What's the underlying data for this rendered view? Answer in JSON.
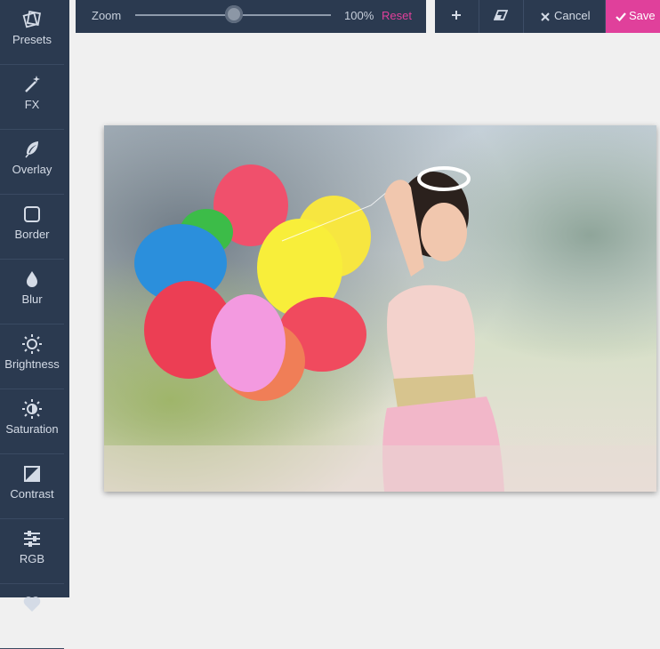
{
  "sidebar": {
    "items": [
      {
        "label": "Presets",
        "icon": "presets-icon"
      },
      {
        "label": "FX",
        "icon": "magic-wand-icon"
      },
      {
        "label": "Overlay",
        "icon": "feather-icon"
      },
      {
        "label": "Border",
        "icon": "square-border-icon"
      },
      {
        "label": "Blur",
        "icon": "droplet-icon"
      },
      {
        "label": "Brightness",
        "icon": "sun-icon"
      },
      {
        "label": "Saturation",
        "icon": "half-sun-icon"
      },
      {
        "label": "Contrast",
        "icon": "contrast-icon"
      },
      {
        "label": "RGB",
        "icon": "sliders-icon"
      }
    ]
  },
  "zoom": {
    "label": "Zoom",
    "value_text": "100%",
    "level": 1.0,
    "reset_label": "Reset"
  },
  "actions": {
    "add_icon": "plus-icon",
    "erase_icon": "eraser-icon",
    "cancel_label": "Cancel",
    "cancel_icon": "close-icon",
    "save_label": "Save",
    "save_icon": "check-icon"
  },
  "colors": {
    "sidebar_bg": "#2b3a50",
    "accent": "#e0409b",
    "canvas_bg": "#f0f0f0"
  }
}
